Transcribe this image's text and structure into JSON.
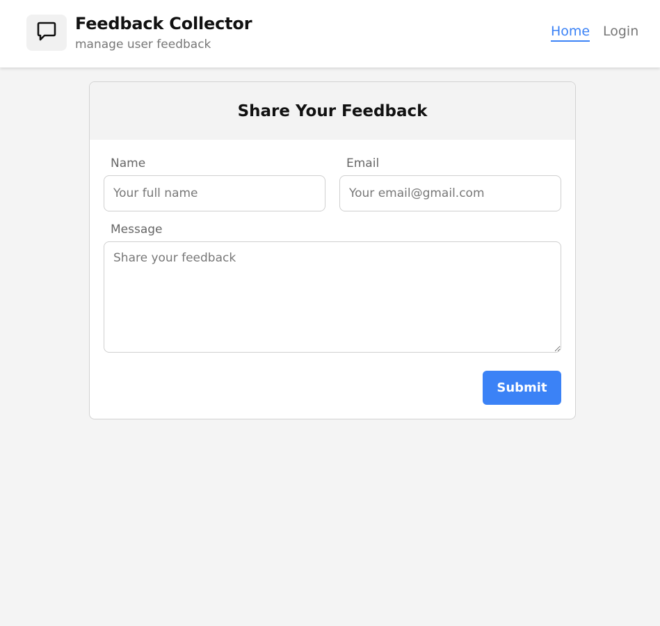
{
  "app": {
    "title": "Feedback Collector",
    "subtitle": "manage user feedback",
    "logo_icon": "chat-bubble-icon"
  },
  "nav": {
    "items": [
      {
        "label": "Home",
        "active": true
      },
      {
        "label": "Login",
        "active": false
      }
    ]
  },
  "form": {
    "title": "Share Your Feedback",
    "name": {
      "label": "Name",
      "placeholder": "Your full name",
      "value": ""
    },
    "email": {
      "label": "Email",
      "placeholder": "Your email@gmail.com",
      "value": ""
    },
    "message": {
      "label": "Message",
      "placeholder": "Share your feedback",
      "value": ""
    },
    "submit_label": "Submit"
  },
  "colors": {
    "accent": "#3b82f6",
    "page_background": "#f4f4f4",
    "muted_text": "#777777"
  }
}
